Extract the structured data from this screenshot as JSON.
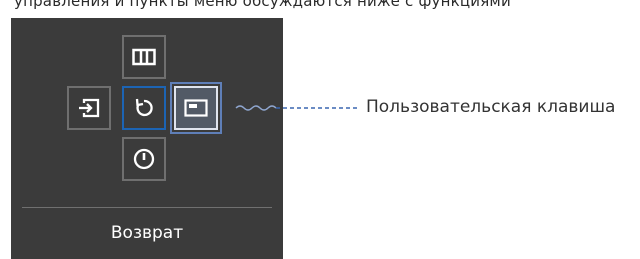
{
  "header": {
    "cut_off_text": "управления и пункты меню обсуждаются ниже с функциями"
  },
  "osd": {
    "buttons": [
      {
        "id": "top",
        "icon": "columns-icon"
      },
      {
        "id": "left",
        "icon": "source-input-icon"
      },
      {
        "id": "center",
        "icon": "return-icon",
        "state": "focused"
      },
      {
        "id": "right",
        "icon": "custom-key-icon",
        "state": "selected"
      },
      {
        "id": "bottom",
        "icon": "power-icon"
      }
    ],
    "label": "Возврат"
  },
  "callout": {
    "label": "Пользовательская клавиша"
  },
  "colors": {
    "panel_bg": "#3b3b3b",
    "button_border": "#6f6f6f",
    "focus_blue": "#1c64b4",
    "selected_ring": "#dfe4ee",
    "leader_line": "#3a66b0"
  }
}
